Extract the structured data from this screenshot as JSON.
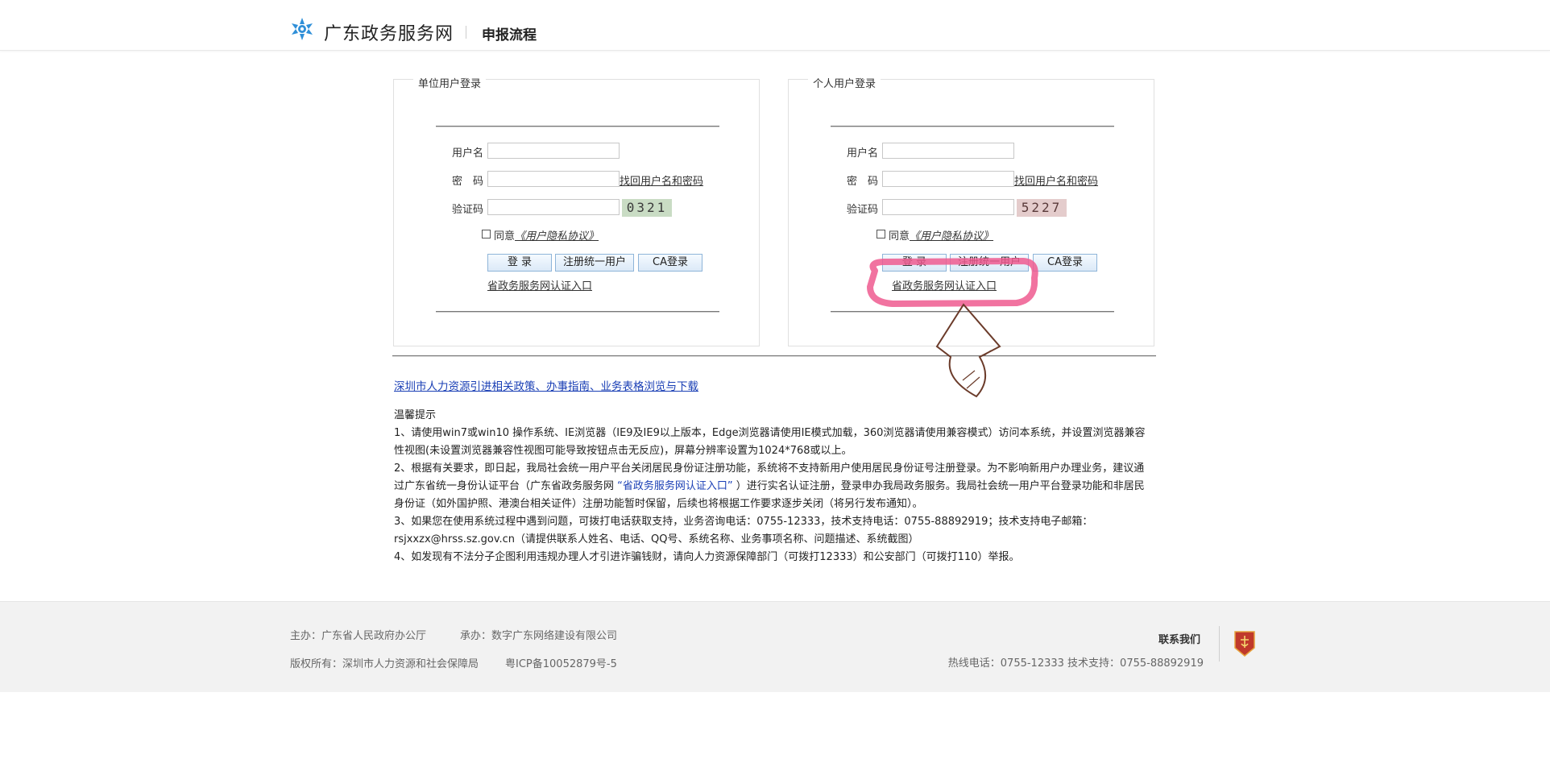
{
  "header": {
    "logo_icon": "snowflake-logo-icon",
    "site_name": "广东政务服务网",
    "page_title": "申报流程"
  },
  "unit_panel": {
    "legend": "单位用户登录",
    "username_label": "用户名",
    "password_label": "密　码",
    "captcha_label": "验证码",
    "find_link": "找回用户名和密码",
    "captcha_text": "0321",
    "agree_prefix": "同意",
    "agree_link": "《用户隐私协议》",
    "login_button": "登 录",
    "register_button": "注册统一用户",
    "ca_button": "CA登录",
    "entry_link": "省政务服务网认证入口"
  },
  "person_panel": {
    "legend": "个人用户登录",
    "username_label": "用户名",
    "password_label": "密　码",
    "captcha_label": "验证码",
    "find_link": "找回用户名和密码",
    "captcha_text": "5227",
    "agree_prefix": "同意",
    "agree_link": "《用户隐私协议》",
    "login_button": "登 录",
    "register_button": "注册统一用户",
    "ca_button": "CA登录",
    "entry_link": "省政务服务网认证入口"
  },
  "policy_link": "深圳市人力资源引进相关政策、办事指南、业务表格浏览与下载",
  "tips": {
    "title": "温馨提示",
    "item1": "1、请使用win7或win10 操作系统、IE浏览器（IE9及IE9以上版本，Edge浏览器请使用IE模式加载，360浏览器请使用兼容模式）访问本系统，并设置浏览器兼容性视图(未设置浏览器兼容性视图可能导致按钮点击无反应)，屏幕分辨率设置为1024*768或以上。",
    "item2_a": "2、根据有关要求，即日起，我局社会统一用户平台关闭居民身份证注册功能，系统将不支持新用户使用居民身份证号注册登录。为不影响新用户办理业务，建议通过广东省统一身份认证平台（广东省政务服务网 ",
    "item2_link": "“省政务服务网认证入口”",
    "item2_b": " ）进行实名认证注册，登录申办我局政务服务。我局社会统一用户平台登录功能和非居民身份证（如外国护照、港澳台相关证件）注册功能暂时保留，后续也将根据工作要求逐步关闭（将另行发布通知）。",
    "item3": "3、如果您在使用系统过程中遇到问题，可拨打电话获取支持，业务咨询电话：0755-12333，技术支持电话：0755-88892919；技术支持电子邮箱：rsjxxzx@hrss.sz.gov.cn（请提供联系人姓名、电话、QQ号、系统名称、业务事项名称、问题描述、系统截图）",
    "item4": "4、如发现有不法分子企图利用违规办理人才引进诈骗钱财，请向人力资源保障部门（可拨打12333）和公安部门（可拨打110）举报。"
  },
  "footer": {
    "sponsor": "主办：广东省人民政府办公厅",
    "organizer": "承办：数字广东网络建设有限公司",
    "copyright": "版权所有：深圳市人力资源和社会保障局",
    "icp": "粤ICP备10052879号-5",
    "contact_title": "联系我们",
    "hotline": "热线电话：0755-12333 技术支持：0755-88892919",
    "badge_icon": "gov-badge-icon"
  },
  "colors": {
    "link_blue": "#1a3fb5",
    "logo_blue": "#2f8fd8",
    "annotation_pink": "#ee5b8f",
    "annotation_brown": "#6b3b2a"
  }
}
